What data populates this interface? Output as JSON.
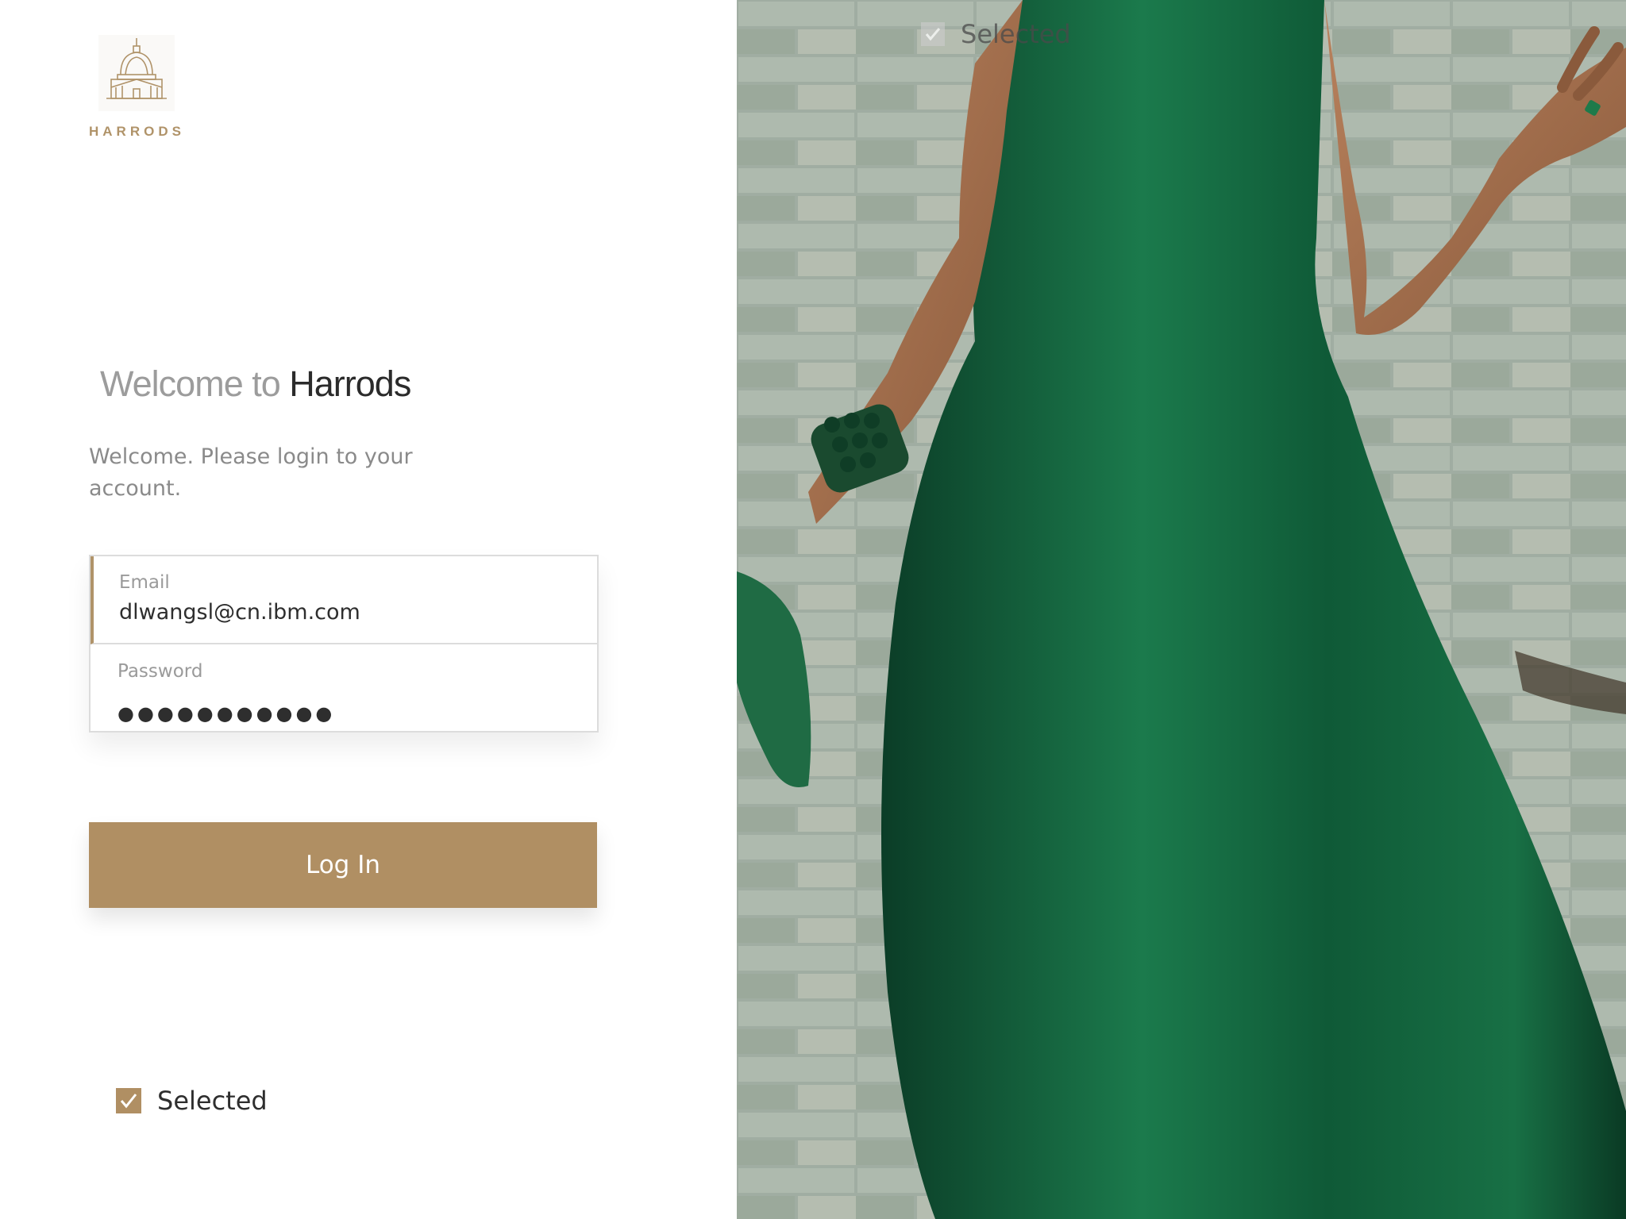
{
  "brand": {
    "logo_text": "HARRODS",
    "logo_icon": "dome-building-icon",
    "accent_color": "#b08f63"
  },
  "welcome": {
    "title_prefix": "Welcome to ",
    "title_brand": "Harrods",
    "subtitle": "Welcome. Please login to your account."
  },
  "form": {
    "email_label": "Email",
    "email_value": "dlwangsl@cn.ibm.com",
    "password_label": "Password",
    "password_masked": "●●●●●●●●●●●"
  },
  "login_button": {
    "label": "Log In"
  },
  "checkbox": {
    "label": "Selected",
    "checked": true,
    "icon": "checkmark-icon"
  },
  "hero_overlay": {
    "label": "Selected",
    "icon": "checkmark-icon"
  },
  "hero_image": {
    "description_icon": "fashion-photo"
  }
}
